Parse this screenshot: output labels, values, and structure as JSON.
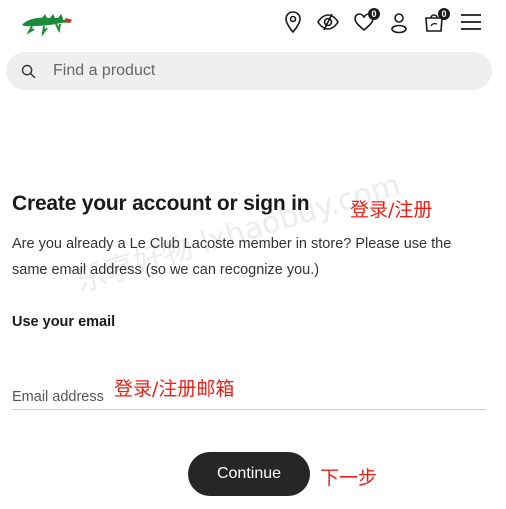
{
  "header": {
    "logo_icon": "lacoste-crocodile-icon",
    "icons": [
      "store-locator-icon",
      "eye-icon",
      "wishlist-heart-icon",
      "account-user-icon",
      "shopping-bag-icon",
      "menu-icon"
    ],
    "wishlist_count": "0",
    "cart_count": "0",
    "brand_color": "#1b8a3a"
  },
  "search": {
    "icon": "search-icon",
    "placeholder": "Find a product"
  },
  "main": {
    "title": "Create your account or sign in",
    "title_annotation": "登录/注册",
    "description": "Are you already a Le Club Lacoste member in store? Please use the same email address (so we can recognize you.)",
    "email_label": "Use your email",
    "email_placeholder": "Email address",
    "email_annotation": "登录/注册邮箱",
    "continue_label": "Continue",
    "continue_annotation": "下一步"
  },
  "watermark": "乐享好物 lxhaobuy.com",
  "colors": {
    "annotation": "#e62117",
    "button": "#262626"
  }
}
